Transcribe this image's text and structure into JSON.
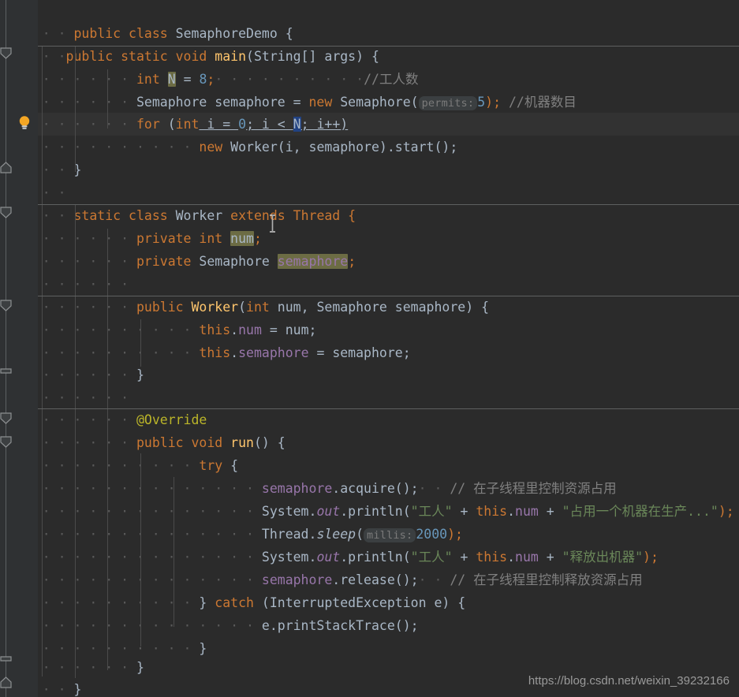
{
  "app": {
    "name": "IntelliJ IDEA Editor",
    "theme": "Darcula",
    "language": "Java",
    "class_name": "SemaphoreDemo"
  },
  "watermark": {
    "text": "https://blog.csdn.net/weixin_39232166"
  },
  "gutter": {
    "bulb_icon": "lightbulb-intention-icon",
    "fold_icon": "fold-arrow-icon"
  },
  "selection": {
    "selected_text": "N",
    "selection_color": "#214283"
  },
  "highlights": {
    "identifier_under_caret_color": "#6c6c44",
    "highlighted_identifiers": [
      "num",
      "semaphore"
    ]
  },
  "hints": [
    {
      "label": "permits:",
      "value": "5"
    },
    {
      "label": "millis:",
      "value": "2000"
    }
  ],
  "colors": {
    "background": "#2b2b2b",
    "gutter": "#313335",
    "keyword": "#cc7832",
    "string": "#6a8759",
    "comment": "#808080",
    "number": "#6897bb",
    "field": "#9876aa",
    "annotation": "#bbb529",
    "class_name": "#ffc66d",
    "default_text": "#a9b7c6"
  },
  "code": {
    "lines": [
      "public class SemaphoreDemo {",
      "",
      "    public static void main(String[] args) {",
      "        int N = 8;            //工人数",
      "        Semaphore semaphore = new Semaphore( permits: 5); //机器数目",
      "        for (int i = 0; i < N; i++)",
      "            new Worker(i, semaphore).start();",
      "    }",
      "",
      "    static class Worker extends Thread {",
      "        private int num;",
      "        private Semaphore semaphore;",
      "",
      "        public Worker(int num, Semaphore semaphore) {",
      "            this.num = num;",
      "            this.semaphore = semaphore;",
      "        }",
      "",
      "        @Override",
      "        public void run() {",
      "            try {",
      "                semaphore.acquire();    // 在子线程里控制资源占用",
      "                System.out.println(\"工人\" + this.num + \"占用一个机器在生产...\");",
      "                Thread.sleep( millis: 2000);",
      "                System.out.println(\"工人\" + this.num + \"释放出机器\");",
      "                semaphore.release();    // 在子线程里控制释放资源占用",
      "            } catch (InterruptedException e) {",
      "                e.printStackTrace();",
      "            }",
      "        }",
      "    }",
      "}"
    ],
    "tokens": {
      "l0": {
        "t1": "public",
        "t2": " class ",
        "t3": "SemaphoreDemo",
        "t4": " {"
      },
      "l2": {
        "t1": "public static void ",
        "t2": "main",
        "t3": "(String[] args) {"
      },
      "l3": {
        "t1": "int ",
        "t2": "N",
        "t3": " = ",
        "t4": "8",
        "t5": ";",
        "t6": "//工人数"
      },
      "l4": {
        "t1": "Semaphore semaphore = ",
        "t2": "new",
        "t3": " Semaphore(",
        "t4": "permits:",
        "t5": "5",
        "t6": ");",
        "t7": "//机器数目"
      },
      "l5": {
        "t1": "for",
        "t2": " (",
        "t3": "int",
        "t4": " i = ",
        "t5": "0",
        "t6": "; i < ",
        "t7": "N",
        "t8": "; i++)"
      },
      "l6": {
        "t1": "new",
        "t2": " Worker(i, semaphore).start();"
      },
      "l7": {
        "t1": "}"
      },
      "l9": {
        "t1": "static class ",
        "t2": "Worker",
        "t3": " extends Thread {"
      },
      "l10": {
        "t1": "private int ",
        "t2": "num",
        "t3": ";"
      },
      "l11": {
        "t1": "private",
        "t2": " Semaphore ",
        "t3": "semaphore",
        "t4": ";"
      },
      "l13": {
        "t1": "public ",
        "t2": "Worker",
        "t3": "(",
        "t4": "int",
        "t5": " num, Semaphore semaphore) {"
      },
      "l14": {
        "t1": "this",
        "t2": ".",
        "t3": "num",
        "t4": " = num;"
      },
      "l15": {
        "t1": "this",
        "t2": ".",
        "t3": "semaphore",
        "t4": " = semaphore;"
      },
      "l16": {
        "t1": "}"
      },
      "l18": {
        "t1": "@Override"
      },
      "l19": {
        "t1": "public void ",
        "t2": "run",
        "t3": "() {"
      },
      "l20": {
        "t1": "try",
        "t2": " {"
      },
      "l21": {
        "t1": "semaphore",
        "t2": ".acquire();",
        "t3": "// 在子线程里控制资源占用"
      },
      "l22": {
        "t1": "System.",
        "t2": "out",
        "t3": ".println(",
        "t4": "\"工人\"",
        "t5": " + ",
        "t6": "this",
        "t7": ".",
        "t8": "num",
        "t9": " + ",
        "t10": "\"占用一个机器在生产...\"",
        "t11": ");"
      },
      "l23": {
        "t1": "Thread.",
        "t2": "sleep",
        "t3": "(",
        "t4": "millis:",
        "t5": "2000",
        "t6": ");"
      },
      "l24": {
        "t1": "System.",
        "t2": "out",
        "t3": ".println(",
        "t4": "\"工人\"",
        "t5": " + ",
        "t6": "this",
        "t7": ".",
        "t8": "num",
        "t9": " + ",
        "t10": "\"释放出机器\"",
        "t11": ");"
      },
      "l25": {
        "t1": "semaphore",
        "t2": ".release();",
        "t3": "// 在子线程里控制释放资源占用"
      },
      "l26": {
        "t1": "} ",
        "t2": "catch",
        "t3": " (InterruptedException e) {"
      },
      "l27": {
        "t1": "e.printStackTrace();"
      },
      "l28": {
        "t1": "}"
      },
      "l29": {
        "t1": "}"
      },
      "l30": {
        "t1": "}"
      },
      "l31": {
        "t1": "}"
      }
    }
  }
}
